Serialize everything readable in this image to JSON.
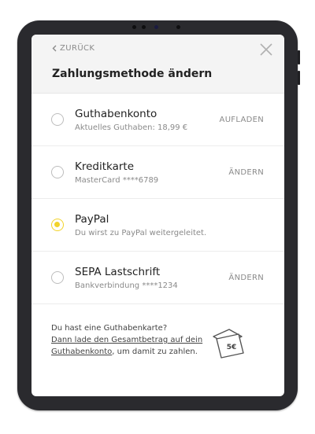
{
  "header": {
    "back_label": "ZURÜCK",
    "title": "Zahlungsmethode ändern"
  },
  "payment_methods": [
    {
      "title": "Guthabenkonto",
      "subtitle": "Aktuelles Guthaben: 18,99 €",
      "action": "AUFLADEN",
      "selected": false
    },
    {
      "title": "Kreditkarte",
      "subtitle": "MasterCard ****6789",
      "action": "ÄNDERN",
      "selected": false
    },
    {
      "title": "PayPal",
      "subtitle": "Du wirst zu PayPal weitergeleitet.",
      "action": "",
      "selected": true
    },
    {
      "title": "SEPA Lastschrift",
      "subtitle": "Bankverbindung ****1234",
      "action": "ÄNDERN",
      "selected": false
    }
  ],
  "footer": {
    "question": "Du hast eine Guthabenkarte?",
    "link_text": "Dann lade den Gesamtbetrag auf dein Guthabenkonto",
    "suffix": ", um damit zu zahlen.",
    "card_value": "5€"
  },
  "colors": {
    "accent": "#f2d32a",
    "device_frame": "#2a2a2e",
    "header_bg": "#f4f4f4",
    "muted_text": "#8a8a8a"
  },
  "icons": [
    "chevron-left-icon",
    "close-icon",
    "gift-card-icon"
  ]
}
